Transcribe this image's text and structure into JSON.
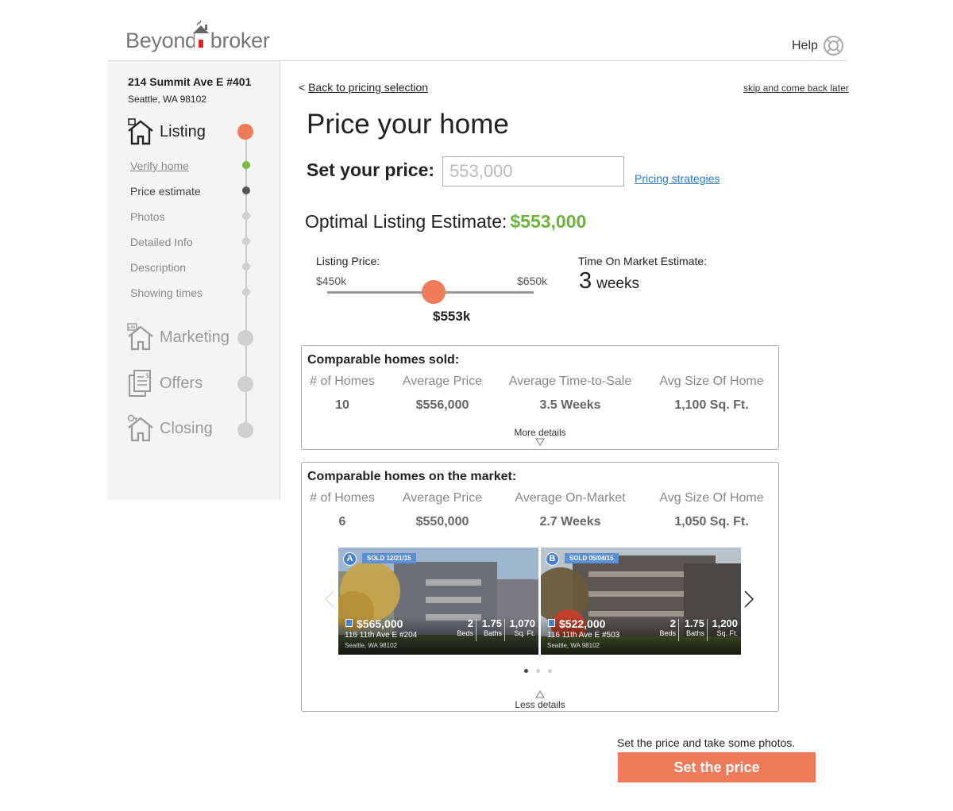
{
  "brand": {
    "name_part1": "Beyond",
    "name_part2": "broker"
  },
  "header": {
    "help_label": "Help"
  },
  "sidebar": {
    "address_line1": "214 Summit Ave E #401",
    "address_line2": "Seattle, WA 98102",
    "steps": [
      {
        "label": "Listing",
        "icon": "house-icon",
        "status": "active"
      },
      {
        "label": "Marketing",
        "icon": "marketing-house-icon",
        "status": "pending"
      },
      {
        "label": "Offers",
        "icon": "offers-documents-icon",
        "status": "pending"
      },
      {
        "label": "Closing",
        "icon": "closing-house-icon",
        "status": "pending"
      }
    ],
    "substeps": [
      {
        "label": "Verify home",
        "status": "complete"
      },
      {
        "label": "Price estimate",
        "status": "current"
      },
      {
        "label": "Photos",
        "status": "pending"
      },
      {
        "label": "Detailed Info",
        "status": "pending"
      },
      {
        "label": "Description",
        "status": "pending"
      },
      {
        "label": "Showing times",
        "status": "pending"
      }
    ]
  },
  "nav": {
    "back_prefix": "<",
    "back_label": "Back to pricing selection",
    "skip_label": "skip and come back later"
  },
  "main": {
    "title": "Price your home",
    "set_price_label": "Set your price:",
    "price_placeholder": "553,000",
    "pricing_strategies_label": "Pricing strategies",
    "optimal_label": "Optimal Listing Estimate:",
    "optimal_value": "$553,000"
  },
  "slider": {
    "label": "Listing Price:",
    "min_label": "$450k",
    "max_label": "$650k",
    "value_label": "$553k",
    "min": 450,
    "max": 650,
    "value": 553
  },
  "time_on_market": {
    "label": "Time On Market Estimate:",
    "value": "3",
    "unit": "weeks"
  },
  "comparables_sold": {
    "title": "Comparable homes sold:",
    "headers": [
      "# of Homes",
      "Average Price",
      "Average Time-to-Sale",
      "Avg Size Of Home"
    ],
    "values": [
      "10",
      "$556,000",
      "3.5 Weeks",
      "1,100 Sq. Ft."
    ],
    "more_label": "More details"
  },
  "comparables_market": {
    "title": "Comparable homes on the market:",
    "headers": [
      "# of Homes",
      "Average Price",
      "Average On-Market",
      "Avg Size Of Home"
    ],
    "values": [
      "6",
      "$550,000",
      "2.7 Weeks",
      "1,050 Sq. Ft."
    ],
    "less_label": "Less details",
    "cards": [
      {
        "badge": "A",
        "sold": "SOLD 12/21/15",
        "price": "$565,000",
        "street": "116 11th Ave E #204",
        "city": "Seattle, WA 98102",
        "beds": "2",
        "beds_label": "Beds",
        "baths": "1.75",
        "baths_label": "Baths",
        "sqft": "1,070",
        "sqft_label": "Sq. Ft."
      },
      {
        "badge": "B",
        "sold": "SOLD 05/04/15",
        "price": "$522,000",
        "street": "116 11th Ave E #503",
        "city": "Seattle, WA 98102",
        "beds": "2",
        "beds_label": "Beds",
        "baths": "1.75",
        "baths_label": "Baths",
        "sqft": "1,200",
        "sqft_label": "Sq. Ft."
      }
    ],
    "pager": {
      "pages": 3,
      "current": 1
    }
  },
  "footer": {
    "hint": "Set the price and take some photos.",
    "cta_label": "Set the price"
  },
  "colors": {
    "accent": "#f07b5b",
    "success": "#6cb33e",
    "link": "#2a79c5",
    "badge": "#4a7fcf"
  }
}
